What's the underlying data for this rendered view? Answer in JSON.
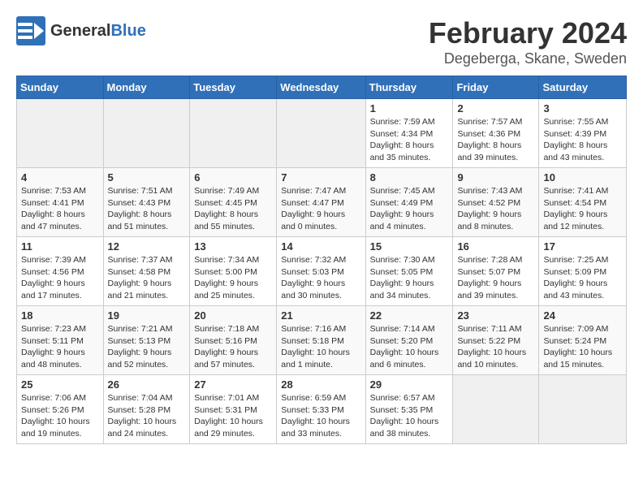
{
  "header": {
    "logo_general": "General",
    "logo_blue": "Blue",
    "title": "February 2024",
    "subtitle": "Degeberga, Skane, Sweden"
  },
  "days_of_week": [
    "Sunday",
    "Monday",
    "Tuesday",
    "Wednesday",
    "Thursday",
    "Friday",
    "Saturday"
  ],
  "weeks": [
    [
      {
        "num": "",
        "info": ""
      },
      {
        "num": "",
        "info": ""
      },
      {
        "num": "",
        "info": ""
      },
      {
        "num": "",
        "info": ""
      },
      {
        "num": "1",
        "info": "Sunrise: 7:59 AM\nSunset: 4:34 PM\nDaylight: 8 hours\nand 35 minutes."
      },
      {
        "num": "2",
        "info": "Sunrise: 7:57 AM\nSunset: 4:36 PM\nDaylight: 8 hours\nand 39 minutes."
      },
      {
        "num": "3",
        "info": "Sunrise: 7:55 AM\nSunset: 4:39 PM\nDaylight: 8 hours\nand 43 minutes."
      }
    ],
    [
      {
        "num": "4",
        "info": "Sunrise: 7:53 AM\nSunset: 4:41 PM\nDaylight: 8 hours\nand 47 minutes."
      },
      {
        "num": "5",
        "info": "Sunrise: 7:51 AM\nSunset: 4:43 PM\nDaylight: 8 hours\nand 51 minutes."
      },
      {
        "num": "6",
        "info": "Sunrise: 7:49 AM\nSunset: 4:45 PM\nDaylight: 8 hours\nand 55 minutes."
      },
      {
        "num": "7",
        "info": "Sunrise: 7:47 AM\nSunset: 4:47 PM\nDaylight: 9 hours\nand 0 minutes."
      },
      {
        "num": "8",
        "info": "Sunrise: 7:45 AM\nSunset: 4:49 PM\nDaylight: 9 hours\nand 4 minutes."
      },
      {
        "num": "9",
        "info": "Sunrise: 7:43 AM\nSunset: 4:52 PM\nDaylight: 9 hours\nand 8 minutes."
      },
      {
        "num": "10",
        "info": "Sunrise: 7:41 AM\nSunset: 4:54 PM\nDaylight: 9 hours\nand 12 minutes."
      }
    ],
    [
      {
        "num": "11",
        "info": "Sunrise: 7:39 AM\nSunset: 4:56 PM\nDaylight: 9 hours\nand 17 minutes."
      },
      {
        "num": "12",
        "info": "Sunrise: 7:37 AM\nSunset: 4:58 PM\nDaylight: 9 hours\nand 21 minutes."
      },
      {
        "num": "13",
        "info": "Sunrise: 7:34 AM\nSunset: 5:00 PM\nDaylight: 9 hours\nand 25 minutes."
      },
      {
        "num": "14",
        "info": "Sunrise: 7:32 AM\nSunset: 5:03 PM\nDaylight: 9 hours\nand 30 minutes."
      },
      {
        "num": "15",
        "info": "Sunrise: 7:30 AM\nSunset: 5:05 PM\nDaylight: 9 hours\nand 34 minutes."
      },
      {
        "num": "16",
        "info": "Sunrise: 7:28 AM\nSunset: 5:07 PM\nDaylight: 9 hours\nand 39 minutes."
      },
      {
        "num": "17",
        "info": "Sunrise: 7:25 AM\nSunset: 5:09 PM\nDaylight: 9 hours\nand 43 minutes."
      }
    ],
    [
      {
        "num": "18",
        "info": "Sunrise: 7:23 AM\nSunset: 5:11 PM\nDaylight: 9 hours\nand 48 minutes."
      },
      {
        "num": "19",
        "info": "Sunrise: 7:21 AM\nSunset: 5:13 PM\nDaylight: 9 hours\nand 52 minutes."
      },
      {
        "num": "20",
        "info": "Sunrise: 7:18 AM\nSunset: 5:16 PM\nDaylight: 9 hours\nand 57 minutes."
      },
      {
        "num": "21",
        "info": "Sunrise: 7:16 AM\nSunset: 5:18 PM\nDaylight: 10 hours\nand 1 minute."
      },
      {
        "num": "22",
        "info": "Sunrise: 7:14 AM\nSunset: 5:20 PM\nDaylight: 10 hours\nand 6 minutes."
      },
      {
        "num": "23",
        "info": "Sunrise: 7:11 AM\nSunset: 5:22 PM\nDaylight: 10 hours\nand 10 minutes."
      },
      {
        "num": "24",
        "info": "Sunrise: 7:09 AM\nSunset: 5:24 PM\nDaylight: 10 hours\nand 15 minutes."
      }
    ],
    [
      {
        "num": "25",
        "info": "Sunrise: 7:06 AM\nSunset: 5:26 PM\nDaylight: 10 hours\nand 19 minutes."
      },
      {
        "num": "26",
        "info": "Sunrise: 7:04 AM\nSunset: 5:28 PM\nDaylight: 10 hours\nand 24 minutes."
      },
      {
        "num": "27",
        "info": "Sunrise: 7:01 AM\nSunset: 5:31 PM\nDaylight: 10 hours\nand 29 minutes."
      },
      {
        "num": "28",
        "info": "Sunrise: 6:59 AM\nSunset: 5:33 PM\nDaylight: 10 hours\nand 33 minutes."
      },
      {
        "num": "29",
        "info": "Sunrise: 6:57 AM\nSunset: 5:35 PM\nDaylight: 10 hours\nand 38 minutes."
      },
      {
        "num": "",
        "info": ""
      },
      {
        "num": "",
        "info": ""
      }
    ]
  ]
}
